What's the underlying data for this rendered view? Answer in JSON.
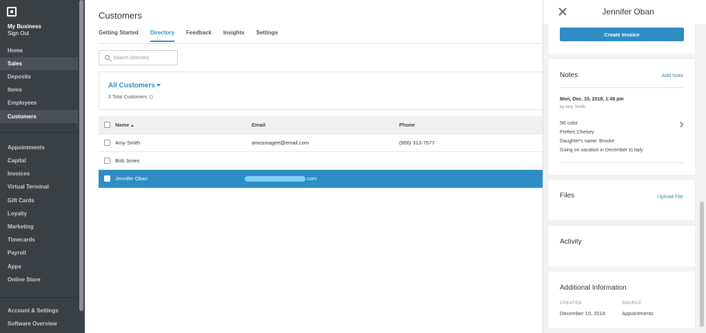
{
  "sidebar": {
    "business_name": "My Business",
    "sign_out": "Sign Out",
    "primary_items": [
      {
        "label": "Home"
      },
      {
        "label": "Sales"
      },
      {
        "label": "Deposits"
      },
      {
        "label": "Items"
      },
      {
        "label": "Employees"
      },
      {
        "label": "Customers"
      }
    ],
    "secondary_items": [
      {
        "label": "Appointments"
      },
      {
        "label": "Capital"
      },
      {
        "label": "Invoices"
      },
      {
        "label": "Virtual Terminal"
      },
      {
        "label": "Gift Cards"
      },
      {
        "label": "Loyalty"
      },
      {
        "label": "Marketing"
      },
      {
        "label": "Timecards"
      },
      {
        "label": "Payroll"
      },
      {
        "label": "Apps"
      },
      {
        "label": "Online Store"
      }
    ],
    "footer_items": [
      {
        "label": "Account & Settings"
      },
      {
        "label": "Software Overview"
      }
    ]
  },
  "main": {
    "title": "Customers",
    "tabs": [
      {
        "label": "Getting Started"
      },
      {
        "label": "Directory"
      },
      {
        "label": "Feedback"
      },
      {
        "label": "Insights"
      },
      {
        "label": "Settings"
      }
    ],
    "search_placeholder": "Search Directory",
    "group_title": "All Customers",
    "group_count": "3 Total Customers",
    "table": {
      "headers": {
        "name": "Name",
        "email": "Email",
        "phone": "Phone"
      },
      "rows": [
        {
          "name": "Amy Smith",
          "email": "amosmagee@email.com",
          "phone": "(956) 313-7577"
        },
        {
          "name": "Bob Jones",
          "email": "",
          "phone": ""
        },
        {
          "name": "Jennifer Oban",
          "email": ".com",
          "phone": ""
        }
      ]
    }
  },
  "panel": {
    "title": "Jennifer Oban",
    "create_invoice": "Create Invoice",
    "notes": {
      "title": "Notes",
      "add_label": "Add Note",
      "date": "Mon, Dec. 10, 2018, 1:48 pm",
      "author": "by Amy Smith",
      "lines": [
        "5R color",
        "Prefers Chelsey",
        "Daughter's name: Brooke",
        "Going on vacation in December to Italy"
      ]
    },
    "files": {
      "title": "Files",
      "upload_label": "Upload File"
    },
    "activity": {
      "title": "Activity"
    },
    "additional": {
      "title": "Additional Information",
      "created_label": "CREATED",
      "created_value": "December 10, 2018",
      "source_label": "SOURCE",
      "source_value": "Appointments"
    }
  },
  "colors": {
    "accent": "#2d8dc4",
    "sidebar": "#3a3f44"
  }
}
